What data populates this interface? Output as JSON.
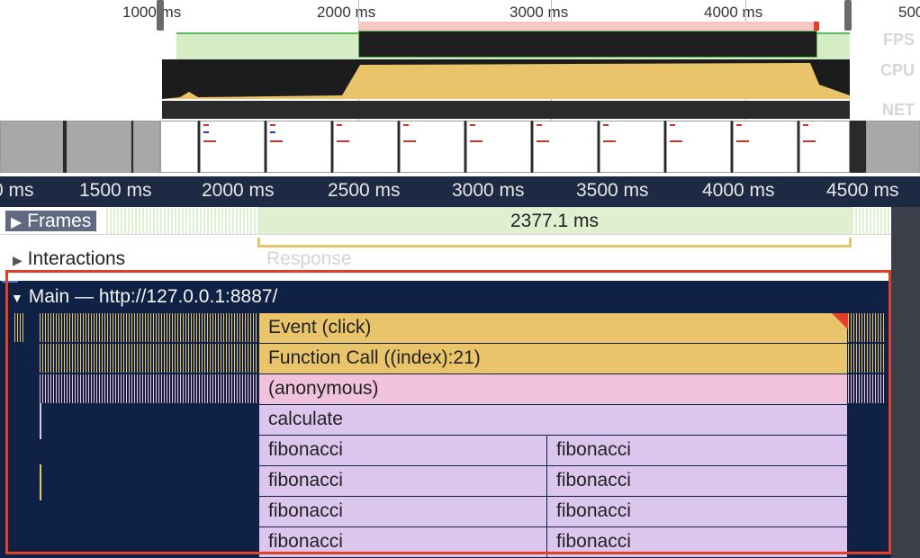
{
  "overview": {
    "ticks": [
      "1000 ms",
      "2000 ms",
      "3000 ms",
      "4000 ms",
      "500"
    ],
    "lanes": [
      "FPS",
      "CPU",
      "NET"
    ]
  },
  "ruler": {
    "ticks": [
      "0 ms",
      "1500 ms",
      "2000 ms",
      "2500 ms",
      "3000 ms",
      "3500 ms",
      "4000 ms",
      "4500 ms"
    ]
  },
  "tracks": {
    "frames_label": "Frames",
    "frames_duration": "2377.1 ms",
    "interactions_label": "Interactions",
    "response_label": "Response",
    "main_label": "Main — http://127.0.0.1:8887/"
  },
  "flame": {
    "event": "Event (click)",
    "function_call": "Function Call ((index):21)",
    "anonymous": "(anonymous)",
    "calculate": "calculate",
    "fib": "fibonacci"
  },
  "colors": {
    "task_yellow": "#e9c46a",
    "script_pink": "#f0c2dc",
    "frame_lilac": "#dcc6ee",
    "selection_red": "#e0402a"
  }
}
